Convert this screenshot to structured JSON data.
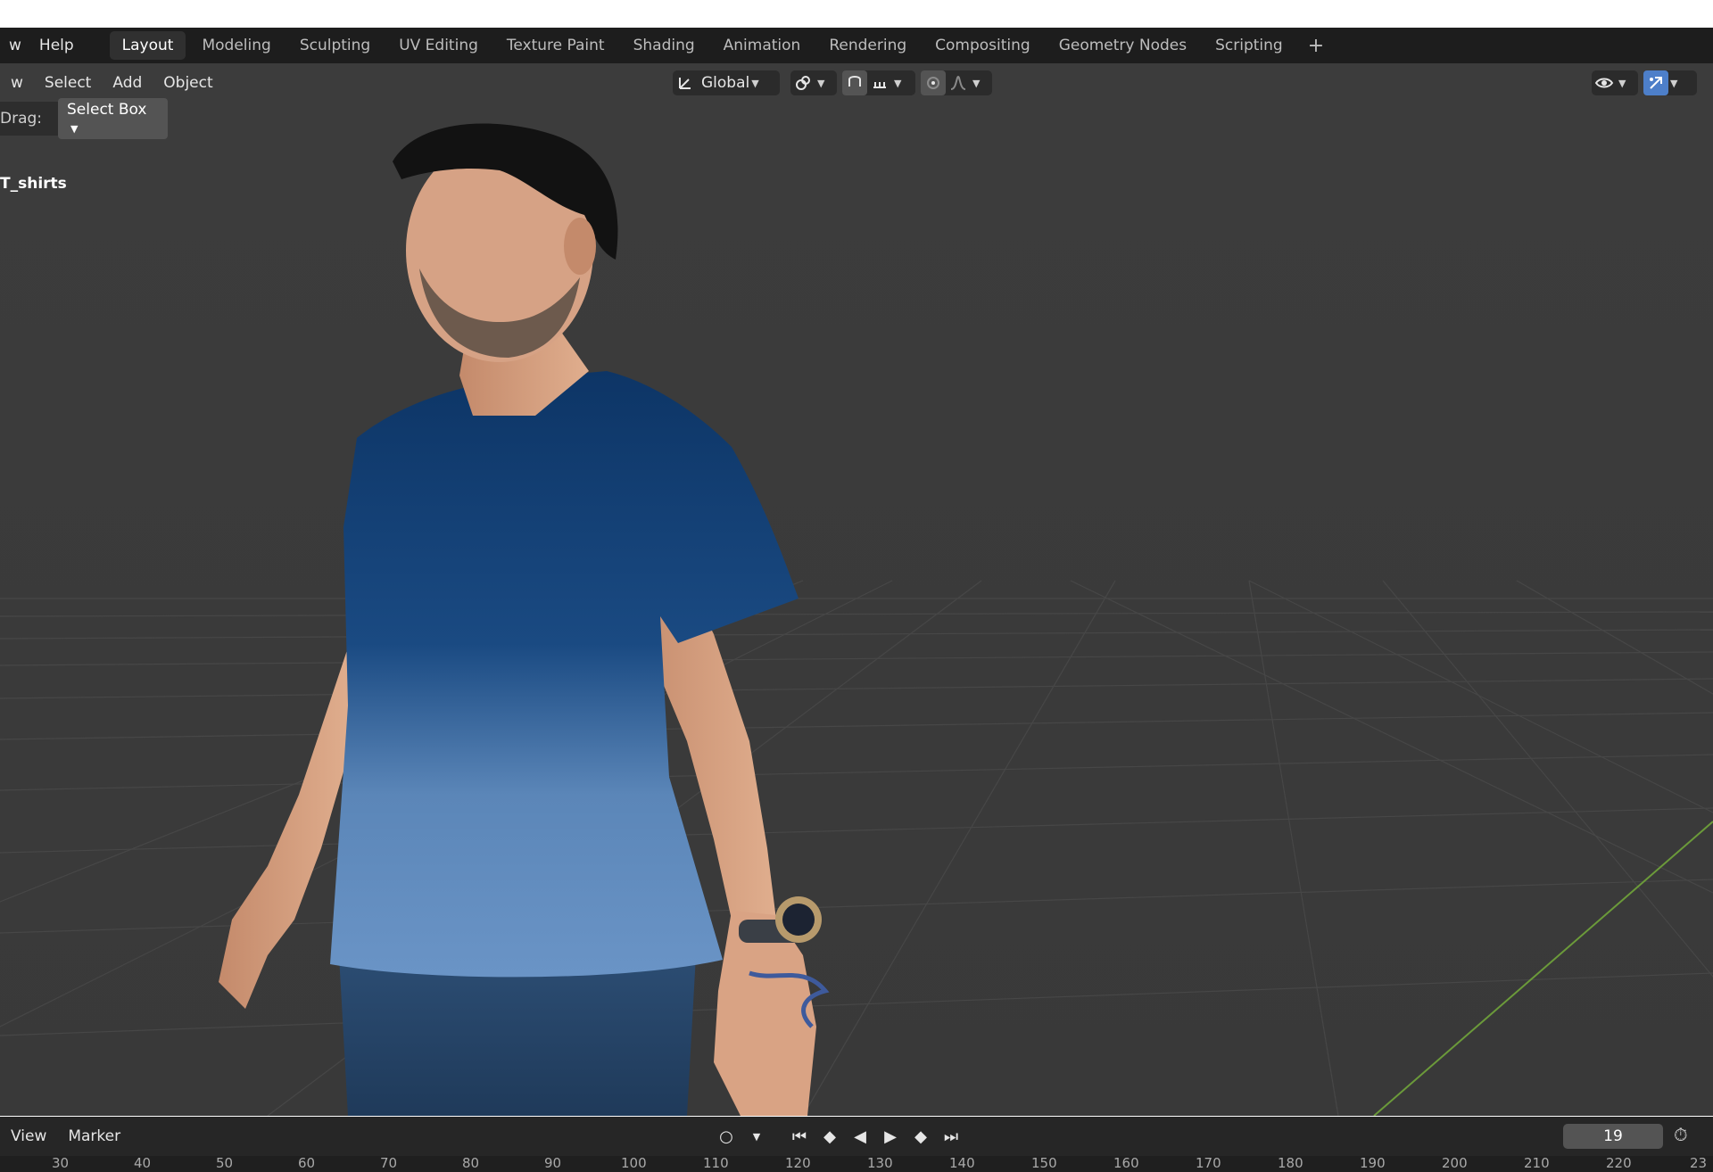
{
  "topbar": {
    "menus": [
      "w",
      "Help"
    ],
    "tabs": [
      {
        "label": "Layout",
        "active": true
      },
      {
        "label": "Modeling"
      },
      {
        "label": "Sculpting"
      },
      {
        "label": "UV Editing"
      },
      {
        "label": "Texture Paint"
      },
      {
        "label": "Shading"
      },
      {
        "label": "Animation"
      },
      {
        "label": "Rendering"
      },
      {
        "label": "Compositing"
      },
      {
        "label": "Geometry Nodes"
      },
      {
        "label": "Scripting"
      }
    ],
    "add_tab": "+"
  },
  "header": {
    "menus": [
      "w",
      "Select",
      "Add",
      "Object"
    ],
    "orientation": "Global"
  },
  "tool": {
    "drag_label": "Drag:",
    "drag_value": "Select Box"
  },
  "viewport": {
    "object_name": "T_shirts"
  },
  "timeline": {
    "menus": [
      "View",
      "Marker"
    ],
    "current_frame": "19",
    "ruler_ticks": [
      "30",
      "40",
      "50",
      "60",
      "70",
      "80",
      "90",
      "100",
      "110",
      "120",
      "130",
      "140",
      "150",
      "160",
      "170",
      "180",
      "190",
      "200",
      "210",
      "220",
      "23"
    ]
  },
  "colors": {
    "accent": "#4d7fc9",
    "viewport_bg": "#3b3b3b",
    "grid": "#4a4a4a",
    "y_axis": "#6b9a3a"
  }
}
